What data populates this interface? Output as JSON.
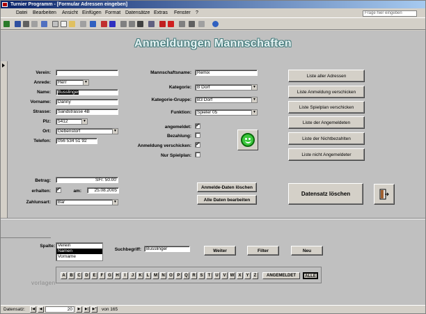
{
  "window": {
    "title": "Turnier Programm - [Formular Adressen eingeben]"
  },
  "menu": [
    "Datei",
    "Bearbeiten",
    "Ansicht",
    "Einfügen",
    "Format",
    "Datensätze",
    "Extras",
    "Fenster",
    "?"
  ],
  "help_placeholder": "Frage hier eingeben",
  "form": {
    "title": "Anmeldungen Mannschaften",
    "left": {
      "verein_label": "Verein:",
      "verein_value": "",
      "anrede_label": "Anrede:",
      "anrede_value": "Herr",
      "name_label": "Name:",
      "name_value": "Busslinger",
      "vorname_label": "Vorname:",
      "vorname_value": "Danny",
      "strasse_label": "Strasse:",
      "strasse_value": "Sandstrasse 4B",
      "plz_label": "Plz:",
      "plz_value": "5412",
      "ort_label": "Ort:",
      "ort_value": "Gebenstorf",
      "telefon_label": "Telefon:",
      "telefon_value": "056 534 51 92"
    },
    "middle": {
      "mannschaft_label": "Mannschaftsname:",
      "mannschaft_value": "Remix",
      "kategorie_label": "Kategorie:",
      "kategorie_value": "B Dorf",
      "gruppe_label": "Kategorie-Gruppe:",
      "gruppe_value": "B3 Dorf",
      "funktion_label": "Funktion:",
      "funktion_value": "Spieler 05",
      "angemeldet_label": "angemeldet:",
      "angemeldet_checked": "✓",
      "bezahlung_label": "Bezahlung:",
      "bezahlung_checked": "",
      "anmeldung_label": "Anmeldung verschicken:",
      "anmeldung_checked": "✓",
      "spielplan_label": "Nur Spielplan:",
      "spielplan_checked": ""
    },
    "payment": {
      "betrag_label": "Betrag:",
      "betrag_value": "SFr. 50.00",
      "erhalten_label": "erhalten:",
      "erhalten_checked": "✓",
      "am_label": "am:",
      "am_value": "25.08.2005",
      "zahlungsart_label": "Zahlunsart:",
      "zahlungsart_value": "Bar"
    },
    "buttons": {
      "anmelde_loeschen": "Anmelde-Daten löschen",
      "alle_bearbeiten": "Alle Daten bearbeiten",
      "liste_adressen": "Liste aller Adressen",
      "liste_anmeldung": "Liste Anmeldung verschicken",
      "liste_spielplan": "Liste Spielplan verschicken",
      "liste_angemeldeten": "Liste der Angemeldeten",
      "liste_nichtbezahlten": "Liste der Nichtbezahlten",
      "liste_nicht_angemeldet": "Liste nicht Angemeldeter",
      "datensatz_loeschen": "Datensatz löschen"
    },
    "search": {
      "spalte_label": "Spalte:",
      "spalte_options": [
        "Verein",
        "Namen",
        "Vorname"
      ],
      "suchbegriff_label": "Suchbegriff:",
      "suchbegriff_value": "Busslinger",
      "weiter": "Weiter",
      "filter": "Filter",
      "neu": "Neu"
    },
    "letters": [
      "A",
      "B",
      "C",
      "D",
      "E",
      "F",
      "G",
      "H",
      "I",
      "J",
      "K",
      "L",
      "M",
      "N",
      "O",
      "P",
      "Q",
      "R",
      "S",
      "T",
      "U",
      "V",
      "W",
      "X",
      "Y",
      "Z"
    ],
    "letter_angemeldet": "ANGEMELDET",
    "letter_alle": "ALLE"
  },
  "nav": {
    "label": "Datensatz:",
    "current": "20",
    "of_label": "von 165"
  },
  "watermark": "vorlagen"
}
